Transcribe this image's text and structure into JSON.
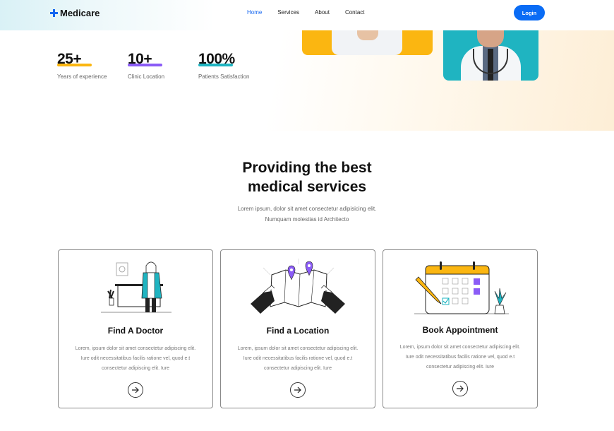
{
  "brand": {
    "name": "Medicare",
    "accent": "#1466f0"
  },
  "nav": {
    "items": [
      {
        "label": "Home",
        "active": true
      },
      {
        "label": "Services",
        "active": false
      },
      {
        "label": "About",
        "active": false
      },
      {
        "label": "Contact",
        "active": false
      }
    ],
    "login_label": "Login"
  },
  "stats": [
    {
      "value": "25+",
      "label": "Years of experience",
      "color": "#fbb611"
    },
    {
      "value": "10+",
      "label": "Clinic Location",
      "color": "#8b5cf6"
    },
    {
      "value": "100%",
      "label": "Patients Satisfaction",
      "color": "#1fb4c1"
    }
  ],
  "services": {
    "title_line1": "Providing the best",
    "title_line2": "medical services",
    "desc_line1": "Lorem ipsum, dolor sit amet consectetur adipisicing elit.",
    "desc_line2": "Numquam molestias id Architecto",
    "cards": [
      {
        "title": "Find A Doctor",
        "icon": "doctor-illustration",
        "desc": [
          "Lorem, ipsum dolor sit amet consectetur adipiscing elit.",
          "Iure odit necessitatibus facilis ratione vel, quod e.t",
          "consectetur adipiscing elit. Iure"
        ]
      },
      {
        "title": "Find a Location",
        "icon": "map-illustration",
        "desc": [
          "Lorem, ipsum dolor sit amet consectetur adipiscing elit.",
          "Iure odit necessitatibus facilis ratione vel, quod e.t",
          "consectetur adipiscing elit. Iure"
        ]
      },
      {
        "title": "Book Appointment",
        "icon": "calendar-illustration",
        "desc": [
          "Lorem, ipsum dolor sit amet consectetur adipiscing elit.",
          "Iure odit necessitatibus facilis ratione vel, quod e.t",
          "consectetur adipiscing elit. Iure"
        ]
      }
    ]
  }
}
